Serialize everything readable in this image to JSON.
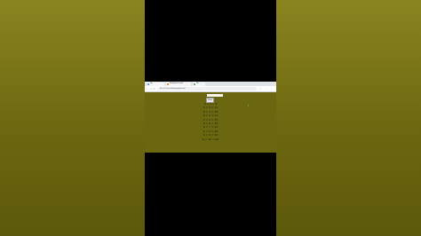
{
  "browser": {
    "tabs": [
      {
        "label": "Tab",
        "color": "#4285f4"
      },
      {
        "label": "Multiplication table",
        "color": "#e8710a"
      },
      {
        "label": "Tab",
        "color": "#34a853"
      }
    ],
    "url": "file:///C:/Users/Desktop/table.html",
    "nav": {
      "back": "←",
      "forward": "→",
      "reload": "↻"
    },
    "toolbar_icons": {
      "star": "☆",
      "ext": "⬚",
      "menu": "⋮"
    }
  },
  "page": {
    "button_label": "Print",
    "lines": [
      "6 × 1 = 6",
      "6 × 2 = 12",
      "6 × 3 = 18",
      "6 × 4 = 24",
      "6 × 5 = 30",
      "6 × 6 = 36",
      "6 × 7 = 42",
      "6 × 8 = 48",
      "6 × 9 = 54",
      "6 × 10 = 60"
    ]
  }
}
